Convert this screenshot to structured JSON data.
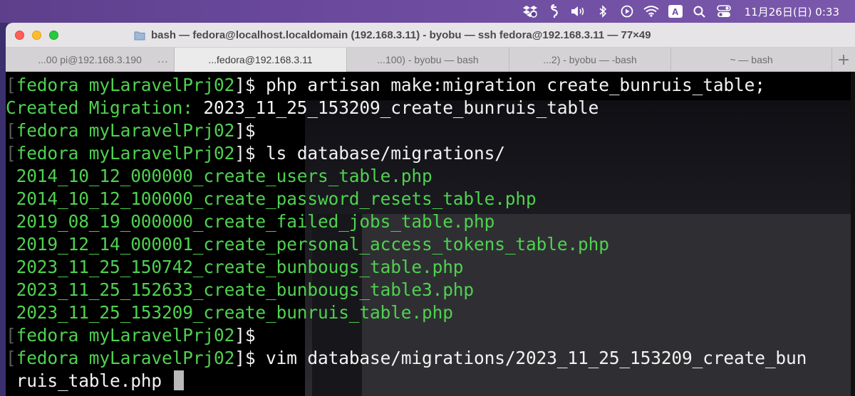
{
  "menubar": {
    "icons": [
      "dropbox-icon",
      "script-icon",
      "volume-icon",
      "bluetooth-icon",
      "play-circle-icon",
      "wifi-icon",
      "ime-icon",
      "search-icon",
      "control-center-icon"
    ],
    "ime_label": "A",
    "clock": "11月26日(日)  0:33"
  },
  "window": {
    "title": "bash — fedora@localhost.localdomain (192.168.3.11) - byobu — ssh fedora@192.168.3.11 — 77×49"
  },
  "tabs": [
    {
      "label": "...00 pi@192.168.3.190",
      "dots": "..."
    },
    {
      "label": "...fedora@192.168.3.11",
      "active": true
    },
    {
      "label": "...100) - byobu — bash"
    },
    {
      "label": "...2) - byobu — -bash"
    },
    {
      "label": "~ — bash"
    }
  ],
  "tab_add": "+",
  "terminal": {
    "prompt": "[fedora myLaravelPrj02]$",
    "lines": [
      {
        "kind": "cmd",
        "text": " php artisan make:migration create_bunruis_table;"
      },
      {
        "kind": "out",
        "text": "Created Migration: ",
        "value": "2023_11_25_153209_create_bunruis_table"
      },
      {
        "kind": "cmd",
        "text": ""
      },
      {
        "kind": "cmd",
        "text": " ls database/migrations/"
      },
      {
        "kind": "file",
        "text": "2014_10_12_000000_create_users_table.php"
      },
      {
        "kind": "file",
        "text": "2014_10_12_100000_create_password_resets_table.php"
      },
      {
        "kind": "file",
        "text": "2019_08_19_000000_create_failed_jobs_table.php"
      },
      {
        "kind": "file",
        "text": "2019_12_14_000001_create_personal_access_tokens_table.php"
      },
      {
        "kind": "file",
        "text": "2023_11_25_150742_create_bunbougs_table.php"
      },
      {
        "kind": "file",
        "text": "2023_11_25_152633_create_bunbougs_table3.php"
      },
      {
        "kind": "file",
        "text": "2023_11_25_153209_create_bunruis_table.php"
      },
      {
        "kind": "cmd",
        "text": ""
      },
      {
        "kind": "cmd",
        "text": " vim database/migrations/2023_11_25_153209_create_bun"
      },
      {
        "kind": "cont",
        "text": "ruis_table.php "
      }
    ]
  }
}
